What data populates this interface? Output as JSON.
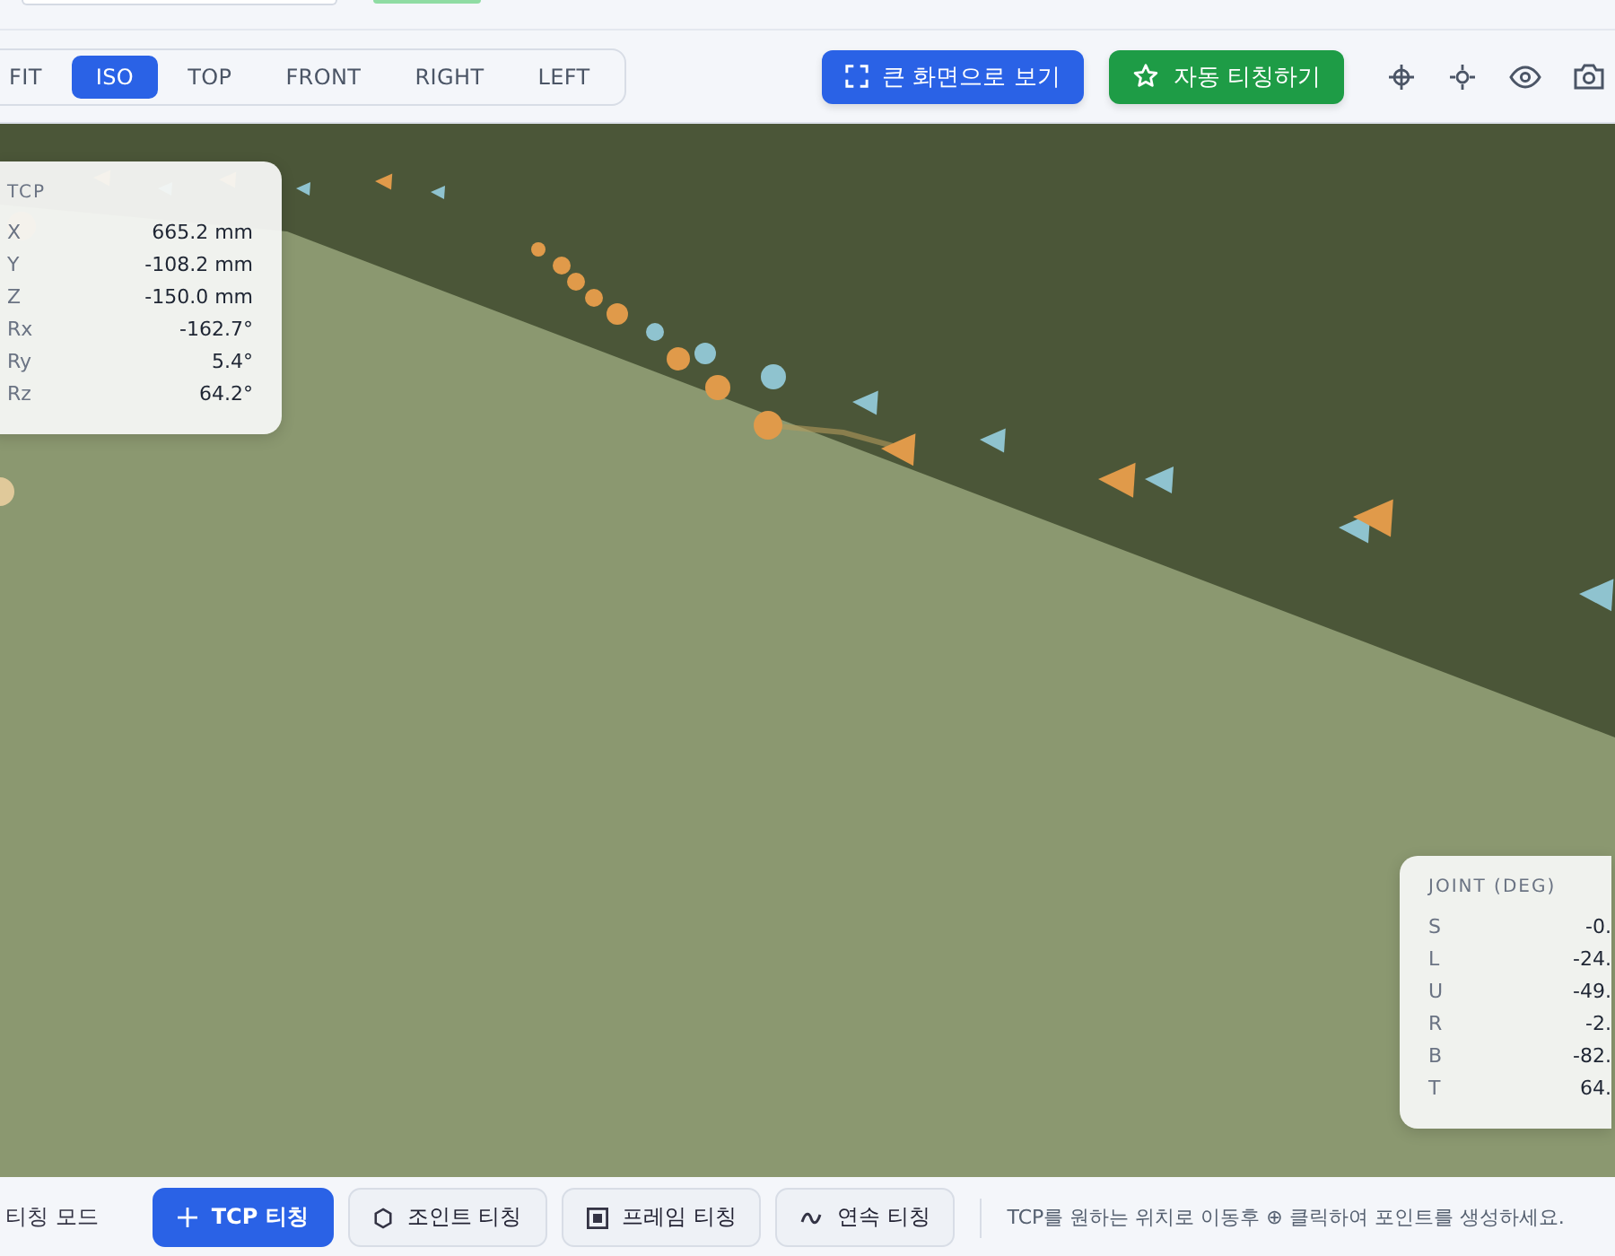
{
  "toolbar": {
    "views": [
      {
        "label": "FIT",
        "selected": false
      },
      {
        "label": "ISO",
        "selected": true
      },
      {
        "label": "TOP",
        "selected": false
      },
      {
        "label": "FRONT",
        "selected": false
      },
      {
        "label": "RIGHT",
        "selected": false
      },
      {
        "label": "LEFT",
        "selected": false
      }
    ],
    "buttons": [
      {
        "label": "큰 화면으로 보기",
        "kind": "fullscreen"
      },
      {
        "label": "자동 티칭하기",
        "kind": "auto"
      }
    ]
  },
  "tcp_panel": {
    "title": "TCP",
    "rows": [
      {
        "axis": "X",
        "value": "665.2 mm"
      },
      {
        "axis": "Y",
        "value": "-108.2 mm"
      },
      {
        "axis": "Z",
        "value": "-150.0 mm"
      },
      {
        "axis": "Rx",
        "value": "-162.7°"
      },
      {
        "axis": "Ry",
        "value": "5.4°"
      },
      {
        "axis": "Rz",
        "value": "64.2°"
      }
    ]
  },
  "joint_panel": {
    "title": "JOINT (DEG)",
    "rows": [
      {
        "axis": "S",
        "value": "-0."
      },
      {
        "axis": "L",
        "value": "-24."
      },
      {
        "axis": "U",
        "value": "-49."
      },
      {
        "axis": "R",
        "value": "-2."
      },
      {
        "axis": "B",
        "value": "-82."
      },
      {
        "axis": "T",
        "value": "64."
      }
    ]
  },
  "teaching_bar": {
    "label": "티칭 모드",
    "modes": [
      {
        "label": "TCP 티칭",
        "selected": true,
        "kind": "tcp"
      },
      {
        "label": "조인트 티칭",
        "selected": false,
        "kind": "joint"
      },
      {
        "label": "프레임 티칭",
        "selected": false,
        "kind": "frame"
      },
      {
        "label": "연속 티칭",
        "selected": false,
        "kind": "continuous"
      }
    ],
    "hint": "TCP를 원하는 위치로 이동후 ⊕ 클릭하여 포인트를 생성하세요."
  }
}
